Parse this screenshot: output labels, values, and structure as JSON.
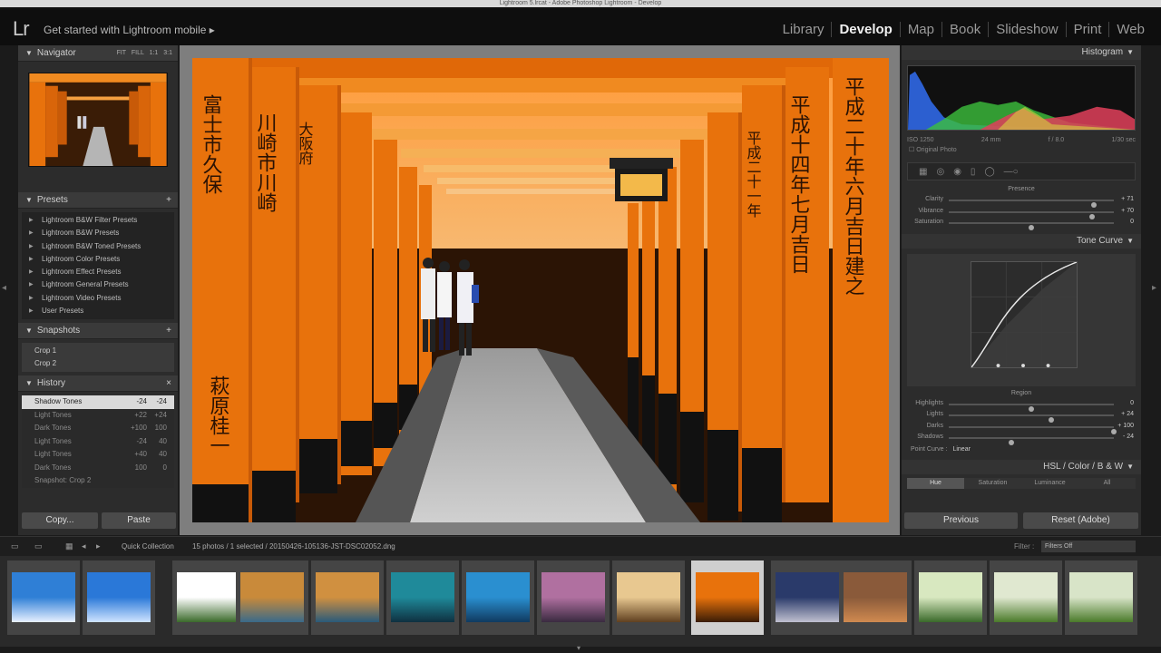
{
  "window": {
    "title": "Lightroom 5.lrcat - Adobe Photoshop Lightroom - Develop"
  },
  "topbar": {
    "logo": "Lr",
    "get_started": "Get started with Lightroom mobile",
    "modules": [
      "Library",
      "Develop",
      "Map",
      "Book",
      "Slideshow",
      "Print",
      "Web"
    ],
    "active_module": "Develop"
  },
  "left_panel": {
    "navigator": {
      "title": "Navigator",
      "modes": "FIT FILL 1:1 3:1"
    },
    "presets": {
      "title": "Presets",
      "items": [
        "Lightroom B&W Filter Presets",
        "Lightroom B&W Presets",
        "Lightroom B&W Toned Presets",
        "Lightroom Color Presets",
        "Lightroom Effect Presets",
        "Lightroom General Presets",
        "Lightroom Video Presets",
        "User Presets"
      ]
    },
    "snapshots": {
      "title": "Snapshots",
      "items": [
        "Crop 1",
        "Crop 2"
      ]
    },
    "history": {
      "title": "History",
      "items": [
        {
          "label": "Shadow Tones",
          "v1": "-24",
          "v2": "-24",
          "selected": true
        },
        {
          "label": "Light Tones",
          "v1": "+22",
          "v2": "+24"
        },
        {
          "label": "Dark Tones",
          "v1": "+100",
          "v2": "100"
        },
        {
          "label": "Light Tones",
          "v1": "-24",
          "v2": "40"
        },
        {
          "label": "Light Tones",
          "v1": "+40",
          "v2": "40"
        },
        {
          "label": "Dark Tones",
          "v1": "100",
          "v2": "0"
        },
        {
          "label": "Snapshot: Crop 2",
          "v1": "",
          "v2": ""
        }
      ]
    },
    "copy_label": "Copy...",
    "paste_label": "Paste"
  },
  "right_panel": {
    "histogram_title": "Histogram",
    "exif": [
      "ISO 1250",
      "24 mm",
      "f / 8.0",
      "1/30 sec"
    ],
    "original_photo": "Original Photo",
    "presence": {
      "title": "Presence",
      "rows": [
        {
          "label": "Clarity",
          "value": "+ 71",
          "pos": 0.88
        },
        {
          "label": "Vibrance",
          "value": "+ 70",
          "pos": 0.87
        },
        {
          "label": "Saturation",
          "value": "0",
          "pos": 0.5
        }
      ]
    },
    "tone_curve_title": "Tone Curve",
    "region": {
      "title": "Region",
      "rows": [
        {
          "label": "Highlights",
          "value": "0",
          "pos": 0.5
        },
        {
          "label": "Lights",
          "value": "+ 24",
          "pos": 0.62
        },
        {
          "label": "Darks",
          "value": "+ 100",
          "pos": 1.0
        },
        {
          "label": "Shadows",
          "value": "- 24",
          "pos": 0.38
        }
      ]
    },
    "point_curve": {
      "label": "Point Curve :",
      "value": "Linear"
    },
    "hsl_title": "HSL / Color / B & W",
    "hsl_tabs": [
      "Hue",
      "Saturation",
      "Luminance",
      "All"
    ],
    "previous_label": "Previous",
    "reset_label": "Reset (Adobe)"
  },
  "toolbar": {
    "quick_collection": "Quick Collection",
    "info": "15 photos / 1 selected / 20150426-105136-JST-DSC02052.dng",
    "filter_label": "Filter :",
    "filter_value": "Filters Off"
  },
  "colors": {
    "accent": "#f39c12",
    "torii": "#e8720c",
    "panel": "#2c2c2c"
  }
}
